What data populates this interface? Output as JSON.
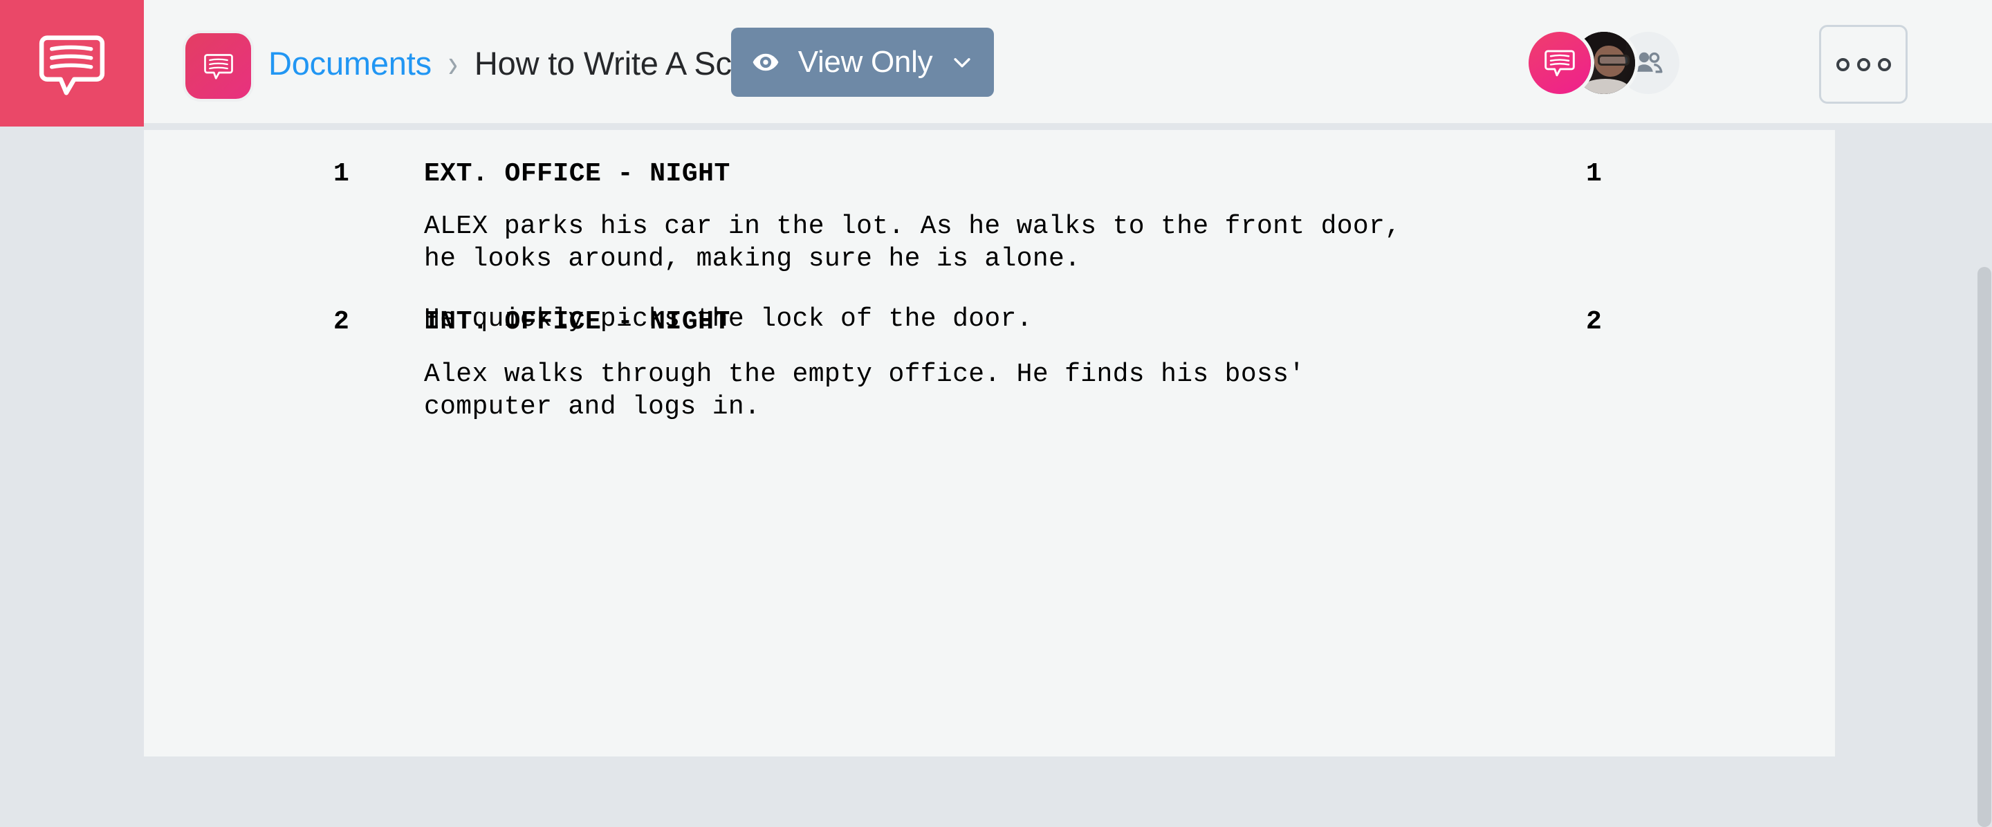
{
  "app": {
    "brand_icon": "speech-bubble-logo-icon",
    "brand_color": "#ea4868",
    "tile_icon": "speech-bubble-icon"
  },
  "header": {
    "breadcrumb": {
      "root_label": "Documents",
      "separator": "›",
      "current_label": "How to Write A Sce..",
      "root_color": "#2196f3"
    },
    "view_mode_button": {
      "label": "View Only",
      "icon": "eye-icon",
      "chevron": "chevron-down-icon",
      "color": "#6e89a6"
    },
    "avatars": [
      {
        "name": "brand-avatar",
        "icon": "speech-bubble-icon"
      },
      {
        "name": "user-avatar-photo",
        "icon": "user-photo"
      },
      {
        "name": "share-avatar",
        "icon": "people-icon"
      }
    ],
    "more_button": {
      "label": "•••",
      "icon": "ellipsis-icon"
    }
  },
  "document": {
    "scenes": [
      {
        "number_left": "1",
        "number_right": "1",
        "heading": "EXT. OFFICE - NIGHT",
        "paragraphs": [
          "ALEX parks his car in the lot. As he walks to the front door,\nhe looks around, making sure he is alone.",
          "He quickly picks the lock of the door."
        ]
      },
      {
        "number_left": "2",
        "number_right": "2",
        "heading": "INT. OFFICE - NIGHT",
        "paragraphs": [
          "Alex walks through the empty office. He finds his boss'\ncomputer and logs in."
        ]
      }
    ]
  },
  "scrollbar": {
    "name": "vertical-scrollbar"
  }
}
